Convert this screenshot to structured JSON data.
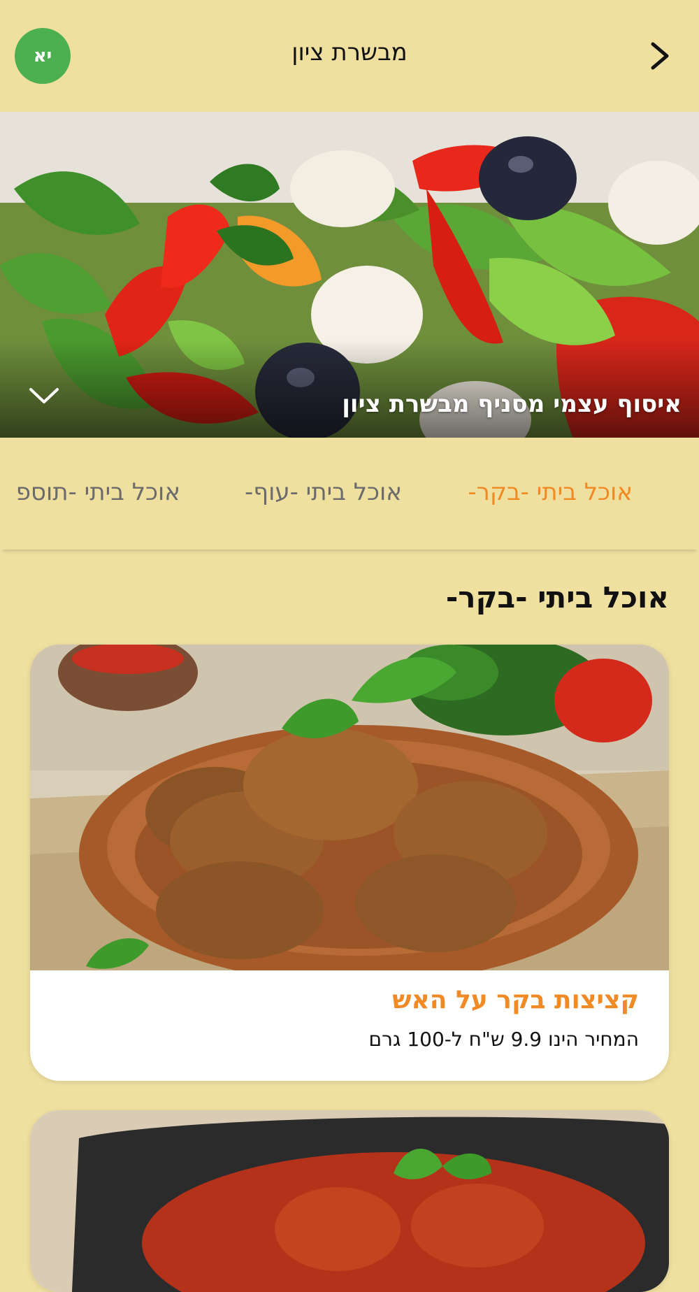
{
  "header": {
    "title": "מבשרת ציון",
    "avatar_initials": "יא",
    "avatar_color": "#4CAF50"
  },
  "hero": {
    "caption": "איסוף עצמי מסניף מבשרת ציון"
  },
  "categories": [
    {
      "label": "אוכל ביתי -בקר-",
      "active": true
    },
    {
      "label": "אוכל ביתי -עוף-",
      "active": false
    },
    {
      "label": "אוכל ביתי -תוספ",
      "active": false
    }
  ],
  "section": {
    "title": "אוכל ביתי -בקר-"
  },
  "products": [
    {
      "title": "קציצות בקר על האש",
      "price_text": "המחיר הינו 9.9 ש\"ח ל-100 גרם"
    },
    {
      "title": "",
      "price_text": ""
    }
  ],
  "colors": {
    "background": "#F0E0A0",
    "accent": "#F08A24",
    "card": "#FFFFFF"
  }
}
